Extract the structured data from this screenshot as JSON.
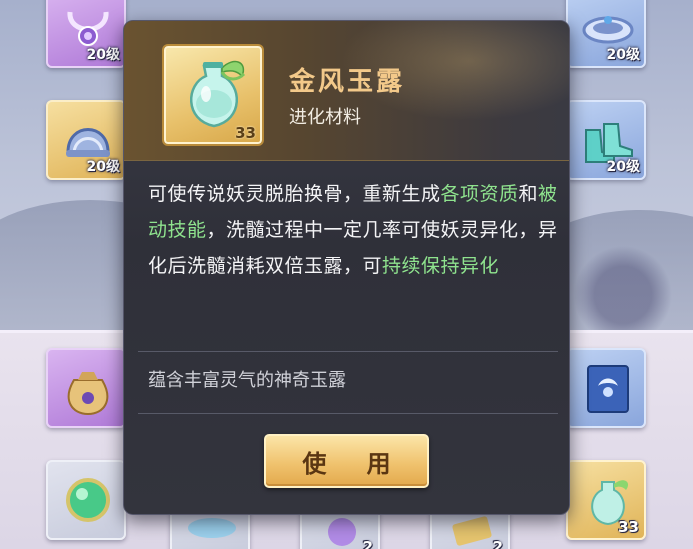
{
  "tooltip": {
    "item_name": "金风玉露",
    "item_type": "进化材料",
    "item_count": "33",
    "description_parts": [
      {
        "text": "可使传说妖灵脱胎换骨，重新生成",
        "highlight": false
      },
      {
        "text": "各项资质",
        "highlight": true
      },
      {
        "text": "和",
        "highlight": false
      },
      {
        "text": "被动技能",
        "highlight": true
      },
      {
        "text": "，洗髓过程中一定几率可使妖灵异化，异化后洗髓消耗双倍玉露，可",
        "highlight": false
      },
      {
        "text": "持续保持异化",
        "highlight": true
      }
    ],
    "flavor_text": "蕴含丰富灵气的神奇玉露",
    "use_button_label": "使 用"
  },
  "inventory": {
    "slots": [
      {
        "icon": "necklace-icon",
        "label": "20级"
      },
      {
        "icon": "crown-icon",
        "label": "20级"
      },
      {
        "icon": "helmet-icon",
        "label": "20级"
      },
      {
        "icon": "boots-icon",
        "label": "20级"
      },
      {
        "icon": "pouch-icon",
        "label": ""
      },
      {
        "icon": "skill-book-icon",
        "label": ""
      },
      {
        "icon": "green-orb-icon",
        "label": ""
      },
      {
        "icon": "pillow-icon",
        "label": ""
      },
      {
        "icon": "purple-fruit-icon",
        "label": "2"
      },
      {
        "icon": "scroll-icon",
        "label": "2"
      },
      {
        "icon": "dew-bottle-icon",
        "label": "33"
      }
    ]
  },
  "colors": {
    "highlight_green": "#8fe38e",
    "title_gold": "#f3c98a",
    "panel_bg": "#2f3039",
    "button_gold": "#f0c36f"
  }
}
